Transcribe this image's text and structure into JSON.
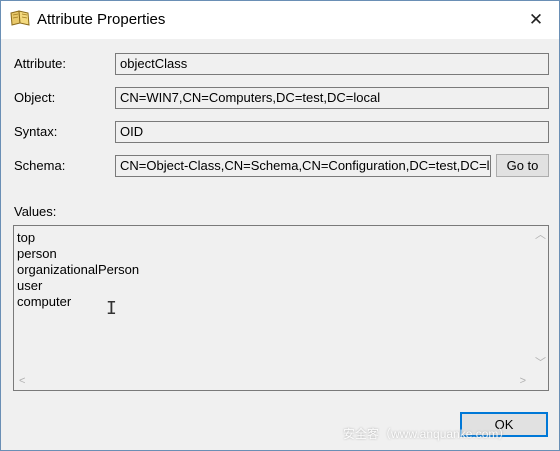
{
  "window": {
    "title": "Attribute Properties",
    "close_symbol": "✕"
  },
  "fields": {
    "attribute": {
      "label": "Attribute:",
      "value": "objectClass"
    },
    "object": {
      "label": "Object:",
      "value": "CN=WIN7,CN=Computers,DC=test,DC=local"
    },
    "syntax": {
      "label": "Syntax:",
      "value": "OID"
    },
    "schema": {
      "label": "Schema:",
      "value": "CN=Object-Class,CN=Schema,CN=Configuration,DC=test,DC=local"
    }
  },
  "buttons": {
    "goto_label": "Go to",
    "ok_label": "OK"
  },
  "values": {
    "label": "Values:",
    "items": [
      "top",
      "person",
      "organizationalPerson",
      "user",
      "computer"
    ]
  },
  "watermark": {
    "text": "安全客（www.anquanke.com）"
  },
  "colors": {
    "accent": "#0078d7",
    "field_border": "#7a7a7a",
    "window_border": "#6a8fb5"
  }
}
